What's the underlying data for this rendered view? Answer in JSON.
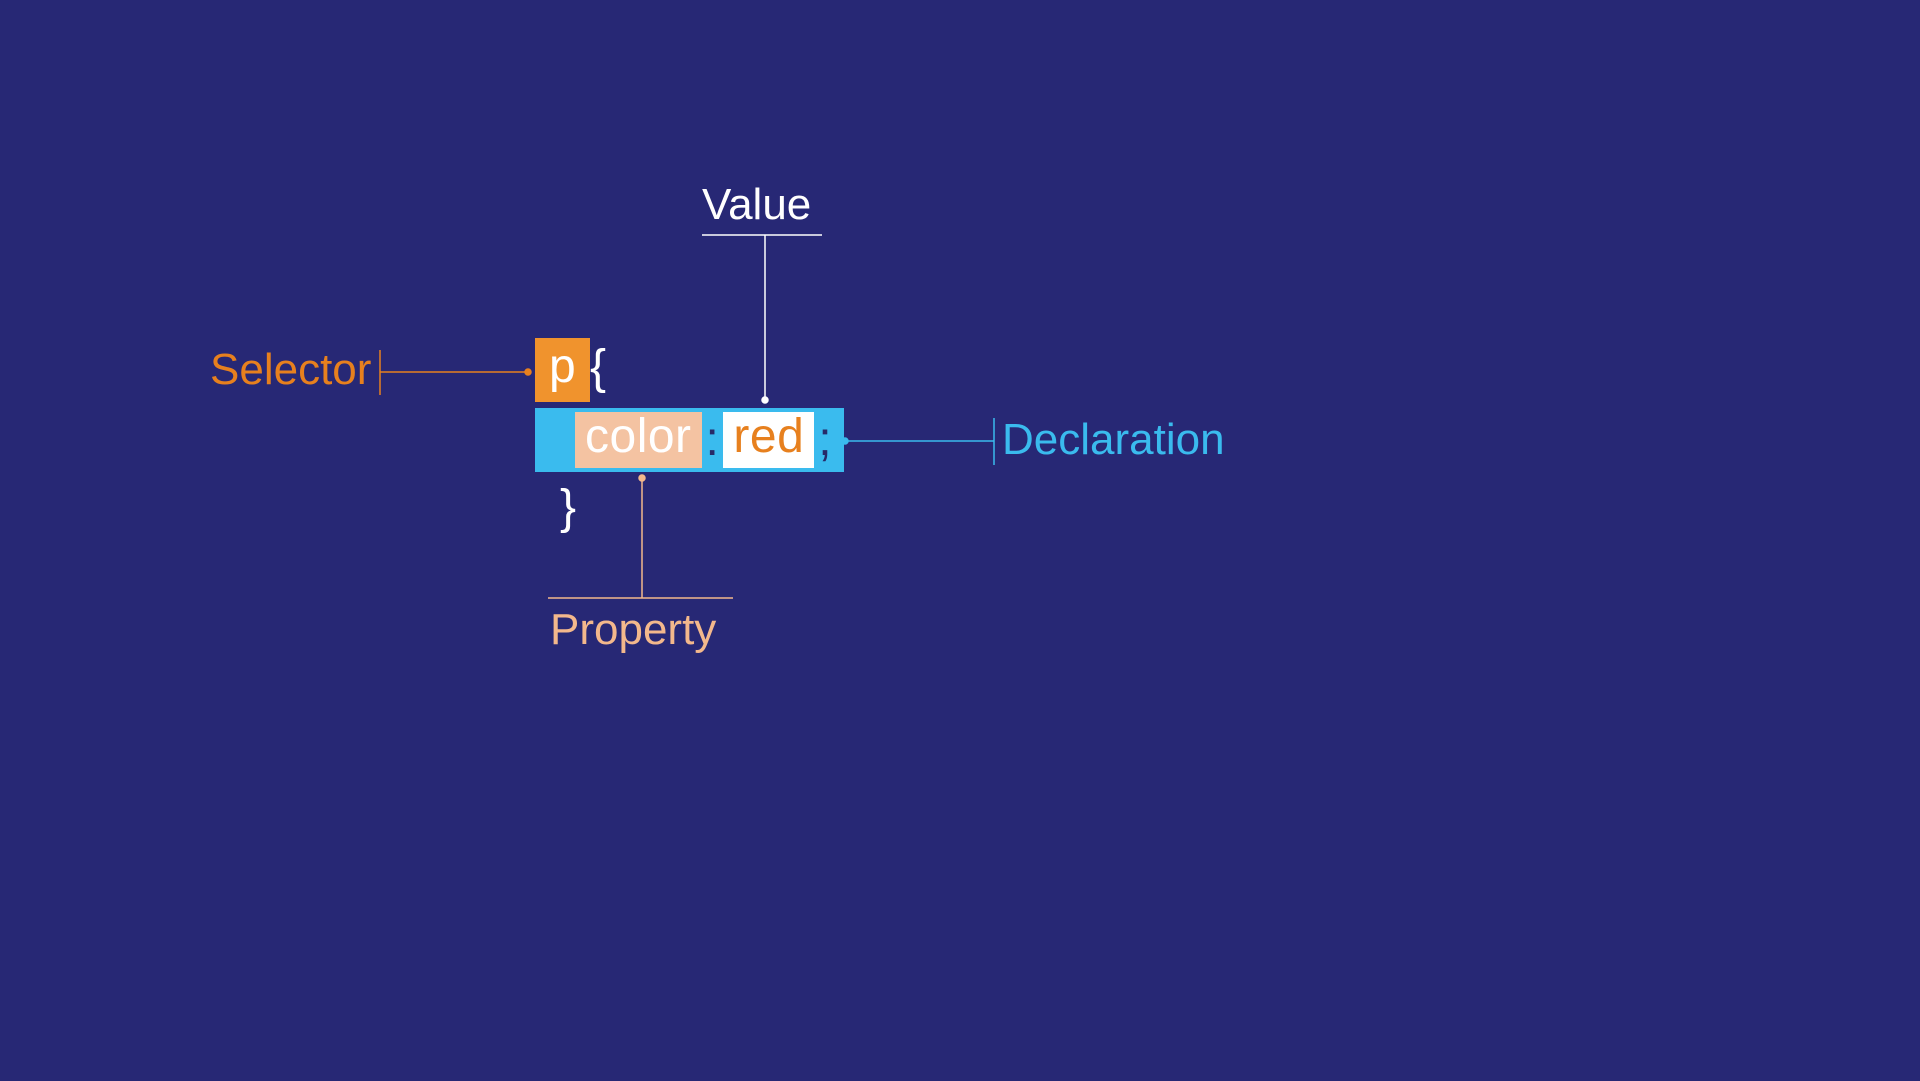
{
  "labels": {
    "value": "Value",
    "selector": "Selector",
    "declaration": "Declaration",
    "property": "Property"
  },
  "code": {
    "selector": "p",
    "open_brace": "{",
    "property": "color",
    "colon": ":",
    "value": "red",
    "semicolon": ";",
    "close_brace": "}"
  },
  "colors": {
    "background": "#272875",
    "orange": "#e7801e",
    "orange_box": "#f0932d",
    "peach": "#f3b88c",
    "cyan": "#3abbee",
    "white": "#ffffff"
  }
}
